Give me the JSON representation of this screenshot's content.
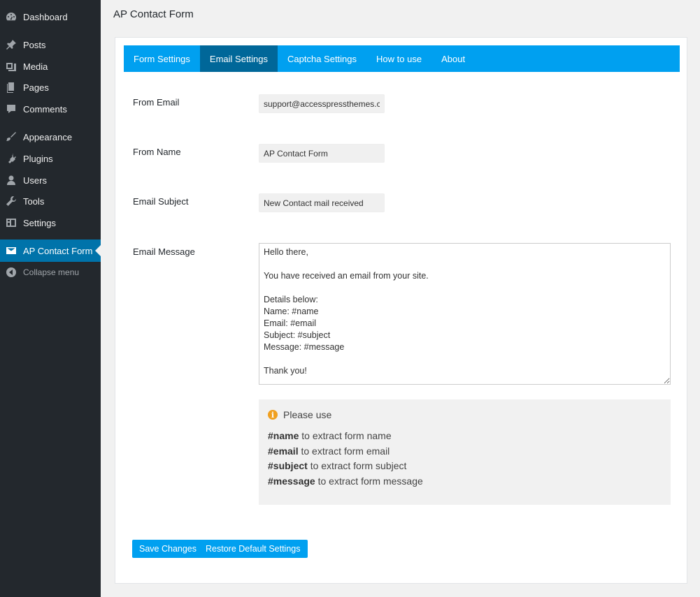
{
  "sidebar": {
    "items": [
      {
        "label": "Dashboard",
        "icon": "dashboard-icon"
      },
      {
        "label": "Posts",
        "icon": "pin-icon"
      },
      {
        "label": "Media",
        "icon": "media-icon"
      },
      {
        "label": "Pages",
        "icon": "pages-icon"
      },
      {
        "label": "Comments",
        "icon": "comment-icon"
      },
      {
        "label": "Appearance",
        "icon": "brush-icon"
      },
      {
        "label": "Plugins",
        "icon": "plugin-icon"
      },
      {
        "label": "Users",
        "icon": "user-icon"
      },
      {
        "label": "Tools",
        "icon": "wrench-icon"
      },
      {
        "label": "Settings",
        "icon": "settings-icon"
      },
      {
        "label": "AP Contact Form",
        "icon": "envelope-icon"
      }
    ],
    "collapse_label": "Collapse menu"
  },
  "page": {
    "title": "AP Contact Form"
  },
  "tabs": [
    {
      "label": "Form Settings"
    },
    {
      "label": "Email Settings"
    },
    {
      "label": "Captcha Settings"
    },
    {
      "label": "How to use"
    },
    {
      "label": "About"
    }
  ],
  "fields": {
    "from_email": {
      "label": "From Email",
      "value": "support@accesspressthemes.com"
    },
    "from_name": {
      "label": "From Name",
      "value": "AP Contact Form"
    },
    "email_subject": {
      "label": "Email Subject",
      "value": "New Contact mail received"
    },
    "email_message": {
      "label": "Email Message",
      "value": "Hello there,\n\nYou have received an email from your site.\n\nDetails below:\nName: #name\nEmail: #email\nSubject: #subject\nMessage: #message\n\nThank you!"
    }
  },
  "info": {
    "heading": "Please use",
    "lines": [
      {
        "tag": "#name",
        "text": " to extract form name"
      },
      {
        "tag": "#email",
        "text": " to extract form email"
      },
      {
        "tag": "#subject",
        "text": " to extract form subject"
      },
      {
        "tag": "#message",
        "text": " to extract form message"
      }
    ]
  },
  "buttons": {
    "save": "Save Changes",
    "restore": "Restore Default Settings"
  },
  "colors": {
    "sidebar_bg": "#23282d",
    "active_menu": "#0073aa",
    "tab_bar": "#00a0f0",
    "active_tab": "#006799",
    "info_icon": "#f0a020"
  }
}
